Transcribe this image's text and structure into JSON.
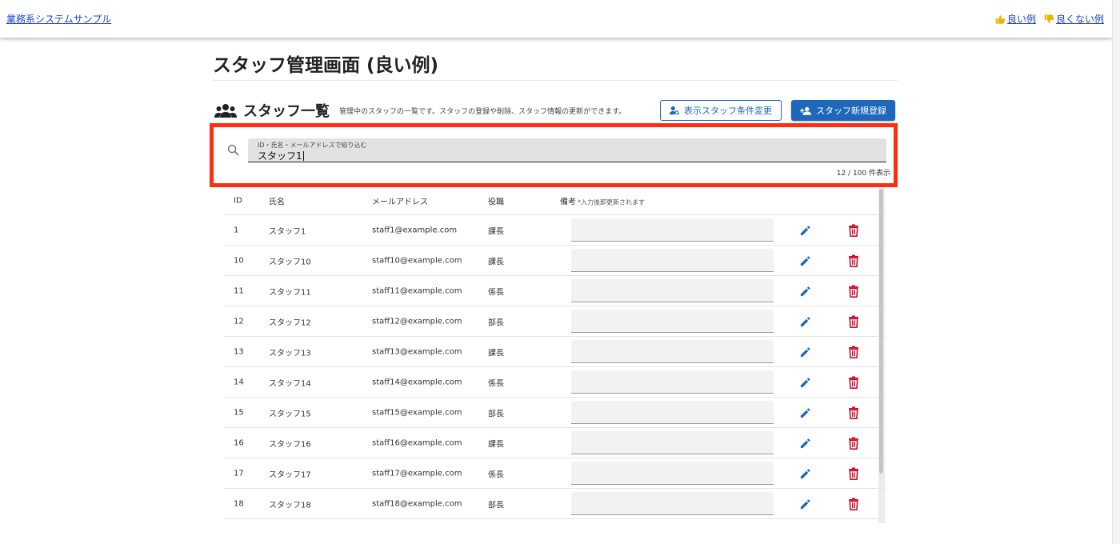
{
  "header": {
    "app_link": "業務系システムサンプル",
    "good_link": "良い例",
    "bad_link": "良くない例"
  },
  "page": {
    "title": "スタッフ管理画面 (良い例)"
  },
  "section": {
    "title": "スタッフ一覧",
    "description": "管理中のスタッフの一覧です。スタッフの登録や削除、スタッフ情報の更新ができます。",
    "filter_button": "表示スタッフ条件変更",
    "register_button": "スタッフ新規登録"
  },
  "search": {
    "label": "ID・氏名・メールアドレスで絞り込む",
    "value": "スタッフ1",
    "count": "12 / 100 件表示"
  },
  "table": {
    "headers": {
      "id": "ID",
      "name": "氏名",
      "email": "メールアドレス",
      "role": "役職",
      "note": "備考",
      "note_hint": "*入力後即更新されます"
    },
    "rows": [
      {
        "id": "1",
        "name": "スタッフ1",
        "email": "staff1@example.com",
        "role": "課長",
        "note": ""
      },
      {
        "id": "10",
        "name": "スタッフ10",
        "email": "staff10@example.com",
        "role": "課長",
        "note": ""
      },
      {
        "id": "11",
        "name": "スタッフ11",
        "email": "staff11@example.com",
        "role": "係長",
        "note": ""
      },
      {
        "id": "12",
        "name": "スタッフ12",
        "email": "staff12@example.com",
        "role": "部長",
        "note": ""
      },
      {
        "id": "13",
        "name": "スタッフ13",
        "email": "staff13@example.com",
        "role": "課長",
        "note": ""
      },
      {
        "id": "14",
        "name": "スタッフ14",
        "email": "staff14@example.com",
        "role": "係長",
        "note": ""
      },
      {
        "id": "15",
        "name": "スタッフ15",
        "email": "staff15@example.com",
        "role": "部長",
        "note": ""
      },
      {
        "id": "16",
        "name": "スタッフ16",
        "email": "staff16@example.com",
        "role": "課長",
        "note": ""
      },
      {
        "id": "17",
        "name": "スタッフ17",
        "email": "staff17@example.com",
        "role": "係長",
        "note": ""
      },
      {
        "id": "18",
        "name": "スタッフ18",
        "email": "staff18@example.com",
        "role": "部長",
        "note": ""
      }
    ]
  },
  "colors": {
    "primary": "#1e67bd",
    "highlight": "#ff2d12",
    "danger": "#c8102e",
    "link": "#1a44c8",
    "thumb_up": "#f0b000"
  }
}
